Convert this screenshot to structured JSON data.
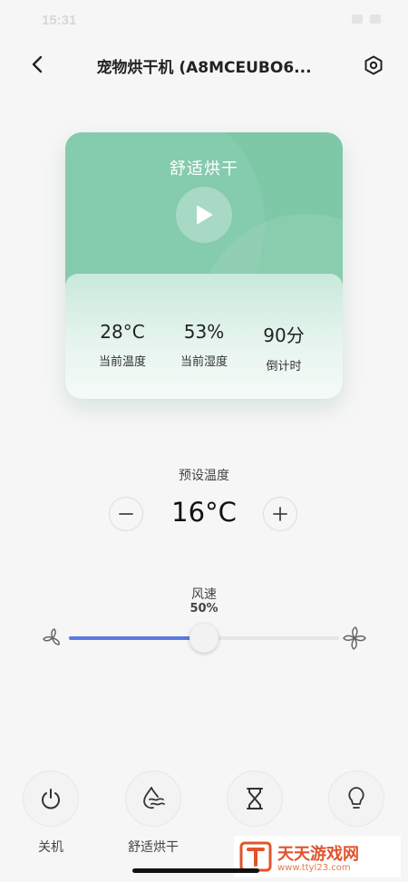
{
  "status_bar": {
    "time": "15:31"
  },
  "header": {
    "title": "宠物烘干机 (A8MCEUBO6..."
  },
  "mode_card": {
    "mode_name": "舒适烘干",
    "stats": [
      {
        "value": "28°C",
        "label": "当前温度"
      },
      {
        "value": "53%",
        "label": "当前湿度"
      },
      {
        "value": "90分",
        "label": "倒计时"
      }
    ]
  },
  "preset_temp": {
    "label": "预设温度",
    "value": "16°C"
  },
  "wind": {
    "label": "风速",
    "value_text": "50%",
    "level": 0.5,
    "accent_color": "#5b79e0"
  },
  "bottom_bar": {
    "buttons": [
      {
        "label": "关机",
        "icon": "power-icon"
      },
      {
        "label": "舒适烘干",
        "icon": "drying-mode-icon"
      },
      {
        "label": "",
        "icon": "hourglass-icon"
      },
      {
        "label": "",
        "icon": "bulb-icon"
      }
    ]
  },
  "watermark": {
    "name": "天天游戏网",
    "url": "www.ttyl23.com"
  }
}
